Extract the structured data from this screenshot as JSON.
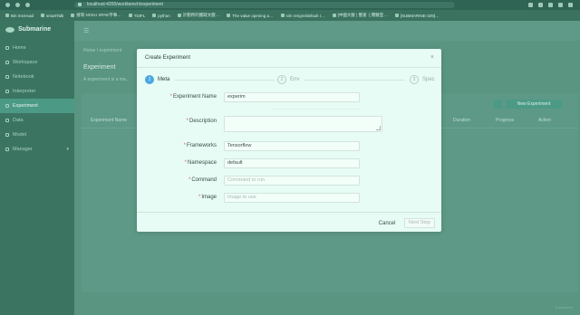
{
  "browser": {
    "url": "localhost:4200/workbench/experiment",
    "bookmarks": [
      "Bin msrecad",
      "smartTalk",
      "搜尋 NCKU SPAE字事…",
      "TDIFL",
      "python",
      "計劃所的獲取文獻…",
      "The value opening a…",
      "sim rengre/default I…",
      "[中國大廈 | 豐富 ·] 實驗室…",
      "[SUBMARINE-329]…"
    ]
  },
  "sidebar": {
    "brand": "Submarine",
    "items": [
      {
        "label": "Home",
        "active": false
      },
      {
        "label": "Workspace",
        "active": false
      },
      {
        "label": "Notebook",
        "active": false
      },
      {
        "label": "Interpreter",
        "active": false
      },
      {
        "label": "Experiment",
        "active": true
      },
      {
        "label": "Data",
        "active": false
      },
      {
        "label": "Model",
        "active": false
      },
      {
        "label": "Manager",
        "active": false,
        "has_caret": true
      }
    ]
  },
  "main": {
    "breadcrumb": "Home / experiment",
    "title": "Experiment",
    "description": "A experiment is a ma...",
    "new_button": "New Experiment",
    "table_headers": {
      "name": "Experiment Name",
      "duration": "Duration",
      "progress": "Progress",
      "action": "Action"
    },
    "watermark": "Submarine"
  },
  "modal": {
    "title": "Create Experiment",
    "steps": [
      {
        "num": "1",
        "label": "Meta",
        "active": true
      },
      {
        "num": "2",
        "label": "Env",
        "active": false
      },
      {
        "num": "3",
        "label": "Spec",
        "active": false
      }
    ],
    "fields": {
      "experiment_name": {
        "label": "Experiment Name",
        "value": "experim"
      },
      "description": {
        "label": "Description",
        "value": ""
      },
      "frameworks": {
        "label": "Frameworks",
        "value": "Tensorflow"
      },
      "namespace": {
        "label": "Namespace",
        "value": "default"
      },
      "command": {
        "label": "Command",
        "placeholder": "Command to run"
      },
      "image": {
        "label": "Image",
        "placeholder": "Image to use"
      }
    },
    "cancel_label": "Cancel",
    "next_label": "Next Step"
  },
  "colors": {
    "accent": "#4aa7e0",
    "sidebar_active": "#4c9a86",
    "required": "#e2636a"
  }
}
